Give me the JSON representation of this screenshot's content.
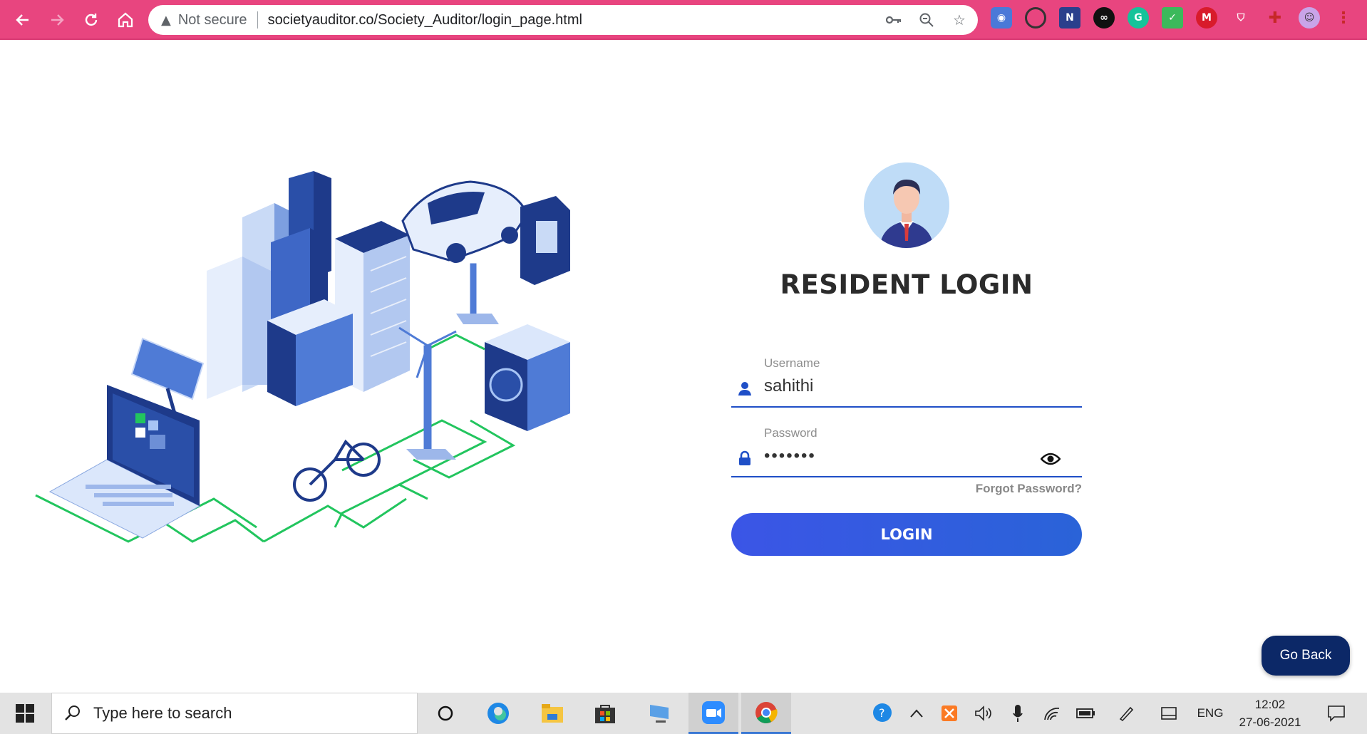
{
  "browser": {
    "security_label": "Not secure",
    "url": "societyauditor.co/Society_Auditor/login_page.html",
    "theme_color": "#e8457f"
  },
  "login": {
    "title": "RESIDENT LOGIN",
    "username_label": "Username",
    "username_value": "sahithi",
    "password_label": "Password",
    "password_value": "•••••••",
    "forgot_label": "Forgot Password?",
    "login_label": "LOGIN",
    "accent_color": "#3b55e6"
  },
  "go_back_label": "Go Back",
  "taskbar": {
    "search_placeholder": "Type here to search",
    "language": "ENG",
    "time": "12:02",
    "date": "27-06-2021"
  }
}
